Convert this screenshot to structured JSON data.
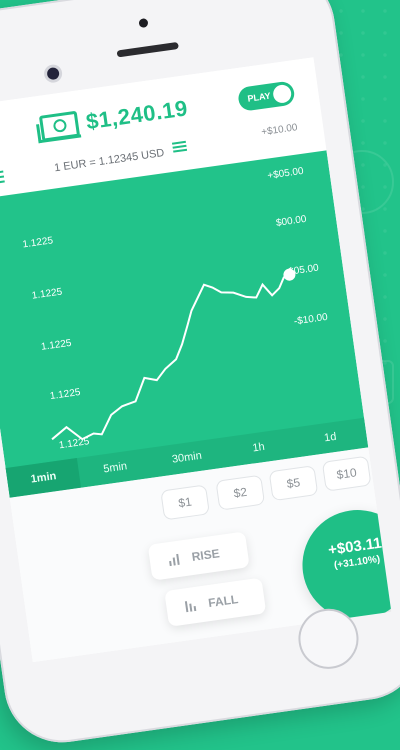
{
  "app": {
    "balance": "$1,240.19",
    "play_label": "PLAY",
    "rate": "1 EUR = 1.12345 USD"
  },
  "right_axis": {
    "labels": [
      "+$10.00",
      "+$05.00",
      "$00.00",
      "-$05.00",
      "-$10.00"
    ]
  },
  "left_axis": {
    "labels": [
      "1.1225",
      "1.1225",
      "1.1225",
      "1.1225",
      "1.1225"
    ]
  },
  "timeframes": [
    "1min",
    "5min",
    "30min",
    "1h",
    "1d"
  ],
  "amounts": [
    "$1",
    "$2",
    "$5",
    "$10"
  ],
  "actions": {
    "rise": "RISE",
    "fall": "FALL"
  },
  "profit": {
    "value": "+$03.11",
    "percent": "(+31.10%)"
  },
  "colors": {
    "accent": "#1fbf86",
    "background": "#22c38a"
  },
  "icons": {
    "money": "money-icon",
    "user": "user-list-icon",
    "list": "list-icon",
    "rise": "rise-chart-icon",
    "fall": "fall-chart-icon"
  }
}
